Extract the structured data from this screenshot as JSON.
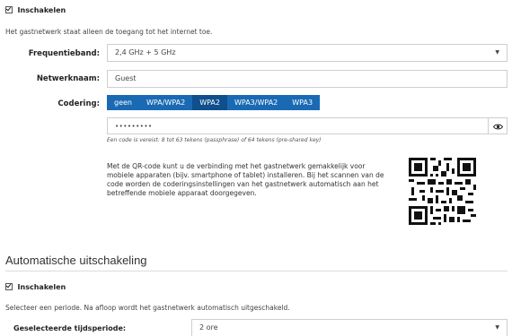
{
  "guest_network": {
    "enable_label": "Inschakelen",
    "info_text": "Het gastnetwerk staat alleen de toegang tot het internet toe.",
    "frequency": {
      "label": "Frequentieband:",
      "value": "2,4 GHz + 5 GHz"
    },
    "network_name": {
      "label": "Netwerknaam:",
      "value": "Guest"
    },
    "encoding": {
      "label": "Codering:",
      "options": [
        "geen",
        "WPA/WPA2",
        "WPA2",
        "WPA3/WPA2",
        "WPA3"
      ],
      "selected": "WPA2"
    },
    "password": {
      "masked_value": "•••••••••",
      "hint": "Een code is vereist: 8 tot 63 tekens (passphrase) of 64 tekens (pre-shared key)"
    },
    "qr_text": "Met de QR-code kunt u de verbinding met het gastnetwerk gemakkelijk voor mobiele apparaten (bijv. smartphone of tablet) installeren. Bij het scannen van de code worden de coderingsinstellingen van het gastnetwerk automatisch aan het betreffende mobiele apparaat doorgegeven."
  },
  "auto_shutdown": {
    "title": "Automatische uitschakeling",
    "enable_label": "Inschakelen",
    "info_text": "Selecteer een periode. Na afloop wordt het gastnetwerk automatisch uitgeschakeld.",
    "period": {
      "label": "Geselecteerde tijdsperiode:",
      "value": "2 ore"
    }
  },
  "icons": {
    "checkbox": "checkbox-checked-icon",
    "dropdown": "chevron-down-icon",
    "eye": "eye-icon",
    "qr": "qr-code-icon"
  },
  "colors": {
    "accent": "#1a6ab3",
    "accent_active": "#0f4f8b"
  }
}
